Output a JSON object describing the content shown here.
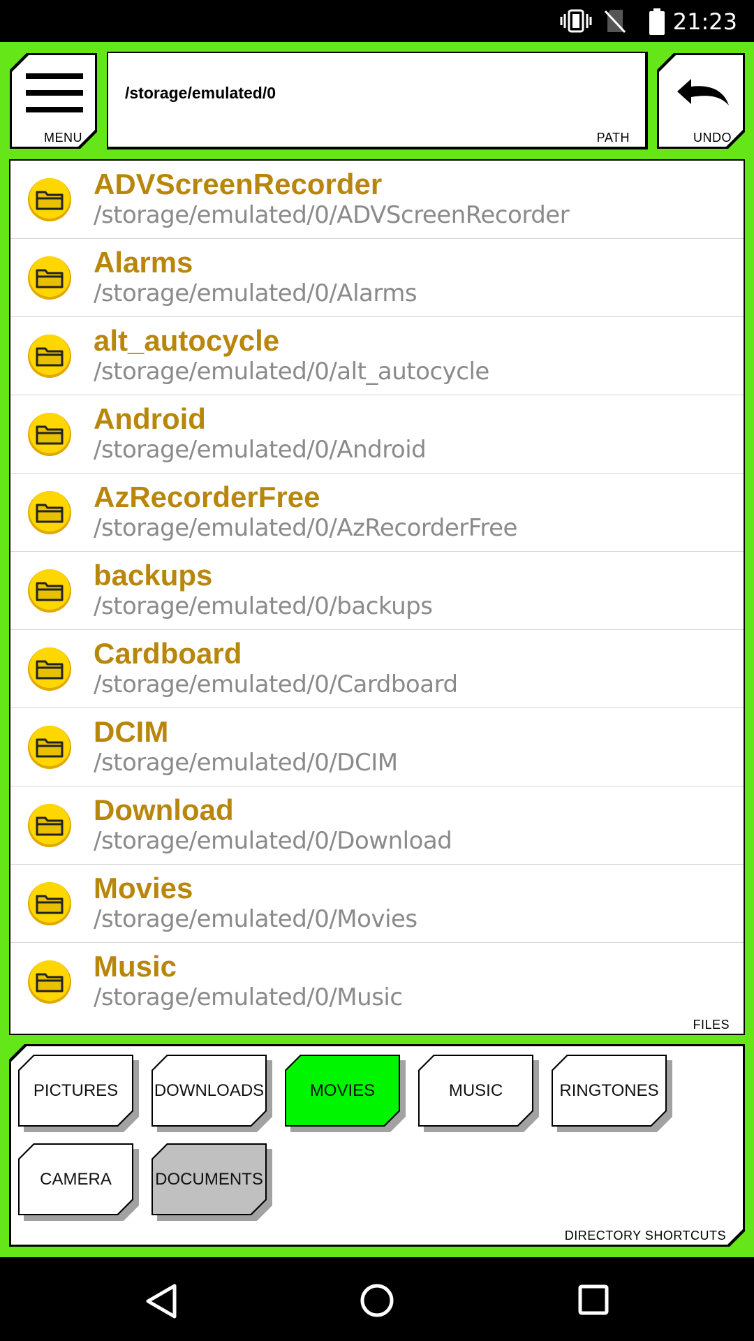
{
  "status_bar": {
    "time": "21:23"
  },
  "header": {
    "menu_label": "MENU",
    "path_value": "/storage/emulated/0",
    "path_label": "PATH",
    "undo_label": "UNDO"
  },
  "files": {
    "label": "FILES",
    "items": [
      {
        "name": "ADVScreenRecorder",
        "path": "/storage/emulated/0/ADVScreenRecorder"
      },
      {
        "name": "Alarms",
        "path": "/storage/emulated/0/Alarms"
      },
      {
        "name": "alt_autocycle",
        "path": "/storage/emulated/0/alt_autocycle"
      },
      {
        "name": "Android",
        "path": "/storage/emulated/0/Android"
      },
      {
        "name": "AzRecorderFree",
        "path": "/storage/emulated/0/AzRecorderFree"
      },
      {
        "name": "backups",
        "path": "/storage/emulated/0/backups"
      },
      {
        "name": "Cardboard",
        "path": "/storage/emulated/0/Cardboard"
      },
      {
        "name": "DCIM",
        "path": "/storage/emulated/0/DCIM"
      },
      {
        "name": "Download",
        "path": "/storage/emulated/0/Download"
      },
      {
        "name": "Movies",
        "path": "/storage/emulated/0/Movies"
      },
      {
        "name": "Music",
        "path": "/storage/emulated/0/Music"
      }
    ]
  },
  "shortcuts": {
    "label": "DIRECTORY SHORTCUTS",
    "items": [
      {
        "label": "PICTURES",
        "state": "normal"
      },
      {
        "label": "DOWNLOADS",
        "state": "normal"
      },
      {
        "label": "MOVIES",
        "state": "active"
      },
      {
        "label": "MUSIC",
        "state": "normal"
      },
      {
        "label": "RINGTONES",
        "state": "normal"
      },
      {
        "label": "CAMERA",
        "state": "normal"
      },
      {
        "label": "DOCUMENTS",
        "state": "grey"
      }
    ]
  },
  "colors": {
    "app_background": "#64e619",
    "folder_name": "#b8860b",
    "folder_icon": "#ffd700",
    "active_shortcut": "#00f500",
    "grey_shortcut": "#c0c0c0"
  },
  "icons": {
    "status": [
      "vibrate-icon",
      "no-sim-icon",
      "battery-icon"
    ],
    "nav": [
      "back-icon",
      "home-icon",
      "recents-icon"
    ]
  }
}
